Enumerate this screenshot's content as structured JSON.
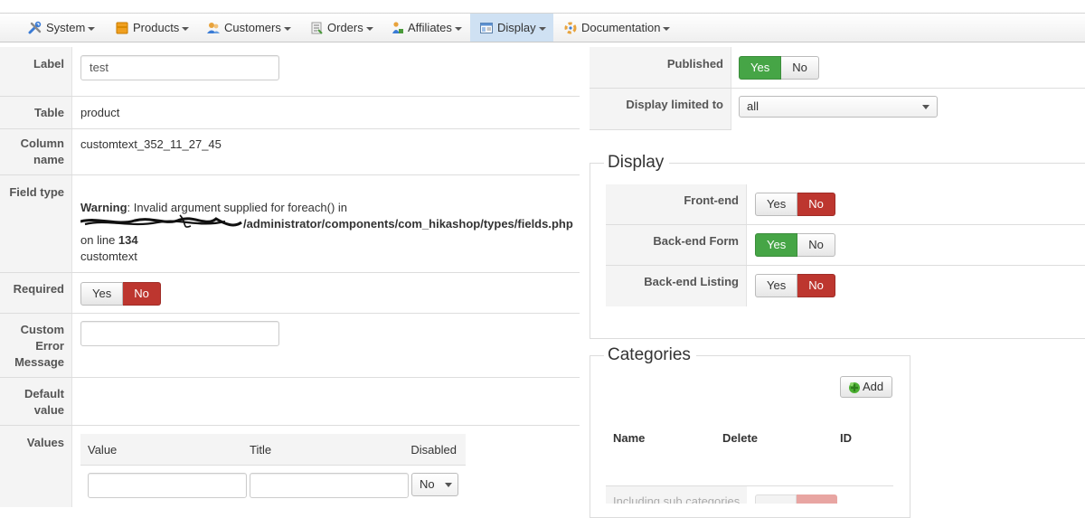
{
  "menu": {
    "items": [
      {
        "label": "System",
        "icon": "tools-icon"
      },
      {
        "label": "Products",
        "icon": "box-icon"
      },
      {
        "label": "Customers",
        "icon": "users-icon"
      },
      {
        "label": "Orders",
        "icon": "orders-icon"
      },
      {
        "label": "Affiliates",
        "icon": "affiliates-icon"
      },
      {
        "label": "Display",
        "icon": "display-icon",
        "active": true
      },
      {
        "label": "Documentation",
        "icon": "documentation-icon"
      }
    ]
  },
  "form": {
    "label": {
      "label": "Label",
      "value": "test"
    },
    "table": {
      "label": "Table",
      "value": "product"
    },
    "column": {
      "label_line1": "Column",
      "label_line2": "name",
      "value": "customtext_352_11_27_45"
    },
    "field_type": {
      "label": "Field type",
      "warning_word": "Warning",
      "warning_text": ": Invalid argument supplied for foreach() in",
      "path": "/administrator/components/com_hikashop/types/fields.php",
      "line_prefix": "on line ",
      "line_number": "134",
      "value": "customtext"
    },
    "required": {
      "label": "Required",
      "yes": "Yes",
      "no": "No",
      "selected": "No"
    },
    "custom_error": {
      "label_line1": "Custom",
      "label_line2": "Error",
      "label_line3": "Message",
      "value": ""
    },
    "default_value": {
      "label_line1": "Default",
      "label_line2": "value"
    },
    "values": {
      "label": "Values",
      "headers": {
        "value": "Value",
        "title": "Title",
        "disabled": "Disabled"
      },
      "disabled_option": "No"
    }
  },
  "publish": {
    "published": {
      "label": "Published",
      "yes": "Yes",
      "no": "No",
      "selected": "Yes"
    },
    "limited": {
      "label": "Display limited to",
      "value": "all"
    }
  },
  "display": {
    "legend": "Display",
    "frontend": {
      "label": "Front-end",
      "yes": "Yes",
      "no": "No",
      "selected": "No"
    },
    "backend_form": {
      "label": "Back-end Form",
      "yes": "Yes",
      "no": "No",
      "selected": "Yes"
    },
    "backend_listing": {
      "label": "Back-end Listing",
      "yes": "Yes",
      "no": "No",
      "selected": "No"
    }
  },
  "categories": {
    "legend": "Categories",
    "add_label": "Add",
    "headers": {
      "name": "Name",
      "delete": "Delete",
      "id": "ID"
    },
    "including_label": "Including sub categories"
  }
}
